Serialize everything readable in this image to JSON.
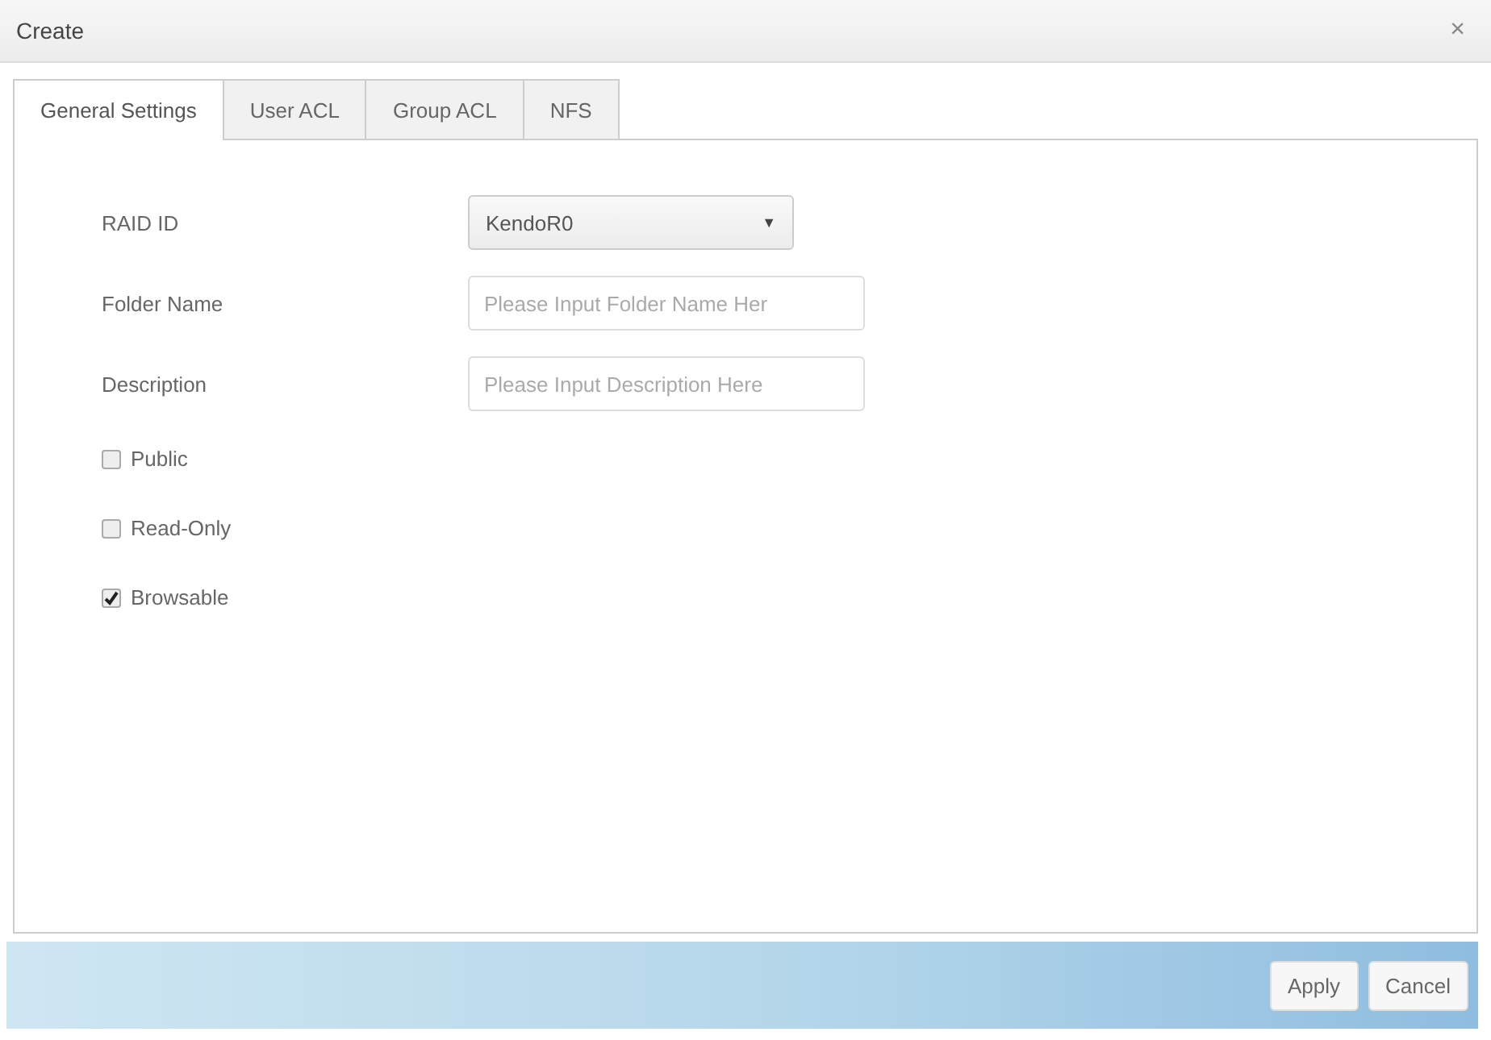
{
  "window": {
    "title": "Create",
    "close": "×"
  },
  "tabs": [
    {
      "label": "General Settings",
      "selected": true
    },
    {
      "label": "User ACL",
      "selected": false
    },
    {
      "label": "Group ACL",
      "selected": false
    },
    {
      "label": "NFS",
      "selected": false
    }
  ],
  "fields": [
    {
      "kind": "select",
      "label": "RAID ID",
      "value": "KendoR0",
      "caret": "▼"
    },
    {
      "kind": "text",
      "label": "Folder Name",
      "placeholder": "Please Input Folder Name Her"
    },
    {
      "kind": "text",
      "label": "Description",
      "placeholder": "Please Input Description Here"
    },
    {
      "kind": "checkbox",
      "label": "Public",
      "checked": false
    },
    {
      "kind": "checkbox",
      "label": "Read-Only",
      "checked": false
    },
    {
      "kind": "checkbox",
      "label": "Browsable",
      "checked": true
    }
  ],
  "buttons": [
    "Apply",
    "Cancel"
  ]
}
